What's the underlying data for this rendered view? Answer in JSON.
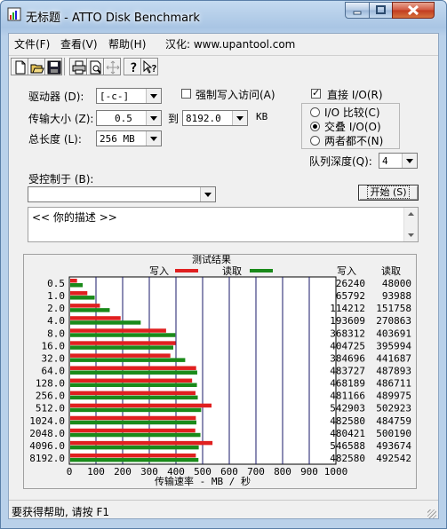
{
  "window": {
    "title": "无标题 - ATTO Disk Benchmark"
  },
  "menu": {
    "file": "文件(F)",
    "view": "查看(V)",
    "help": "帮助(H)",
    "credit": "汉化: www.upantool.com"
  },
  "toolbar": {
    "icons": [
      "new-icon",
      "open-icon",
      "save-icon",
      "print-icon",
      "print-preview-icon",
      "move-icon",
      "help-icon",
      "context-help-icon"
    ]
  },
  "controls": {
    "drive_label": "驱动器 (D):",
    "drive_value": "[-c-]",
    "force_write_label": "强制写入访问(A)",
    "direct_io_label": "直接 I/O(R)",
    "transfer_label": "传输大小 (Z):",
    "transfer_from": "0.5",
    "to_label": "到",
    "transfer_to": "8192.0",
    "kb_label": "KB",
    "total_label": "总长度 (L):",
    "total_value": "256 MB",
    "io_compare_label": "I/O 比较(C)",
    "overlap_io_label": "交叠 I/O(O)",
    "neither_label": "两者都不(N)",
    "queue_label": "队列深度(Q):",
    "queue_value": "4",
    "controlled_label": "受控制于 (B):",
    "controlled_value": "",
    "start_button": "开始 (S)",
    "description": "<<  你的描述   >>"
  },
  "chart_data": {
    "type": "bar",
    "title": "测试结果",
    "legend": [
      {
        "name": "写入",
        "color": "#e02020"
      },
      {
        "name": "读取",
        "color": "#1a8a1a"
      }
    ],
    "col_headers": {
      "write": "写入",
      "read": "读取"
    },
    "categories": [
      "0.5",
      "1.0",
      "2.0",
      "4.0",
      "8.0",
      "16.0",
      "32.0",
      "64.0",
      "128.0",
      "256.0",
      "512.0",
      "1024.0",
      "2048.0",
      "4096.0",
      "8192.0"
    ],
    "series": [
      {
        "name": "写入",
        "values": [
          26240,
          65792,
          114212,
          193609,
          368312,
          404725,
          384696,
          483727,
          468189,
          481166,
          542903,
          482580,
          480421,
          546588,
          482580
        ]
      },
      {
        "name": "读取",
        "values": [
          48000,
          93988,
          151758,
          270863,
          403691,
          395994,
          441687,
          487893,
          486711,
          489975,
          502923,
          484759,
          500190,
          493674,
          492542
        ]
      }
    ],
    "x_ticks": [
      "0",
      "100",
      "200",
      "300",
      "400",
      "500",
      "600",
      "700",
      "800",
      "900",
      "1000"
    ],
    "xlabel": "传输速率 - MB / 秒",
    "xlim": [
      0,
      1000
    ],
    "grid": true
  },
  "status": {
    "text": "要获得帮助, 请按 F1"
  }
}
